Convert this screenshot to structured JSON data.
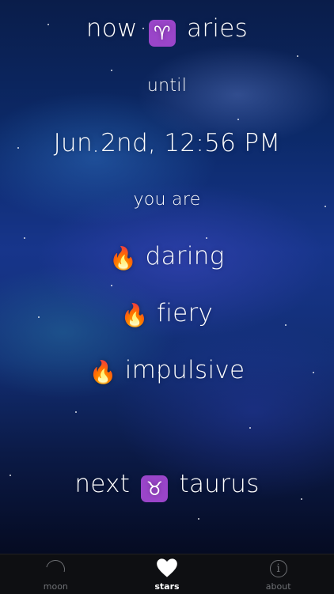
{
  "current": {
    "prefix": "now",
    "sign_glyph": "♈",
    "sign_name": "aries"
  },
  "until_label": "until",
  "until_datetime": "Jun 2nd, 12:56 PM",
  "traits_label": "you are",
  "traits": [
    {
      "emoji": "🔥",
      "text": "daring"
    },
    {
      "emoji": "🔥",
      "text": "fiery"
    },
    {
      "emoji": "🔥",
      "text": "impulsive"
    }
  ],
  "next": {
    "prefix": "next",
    "sign_glyph": "♉",
    "sign_name": "taurus"
  },
  "tabs": [
    {
      "label": "moon",
      "icon": "moon-icon"
    },
    {
      "label": "stars",
      "icon": "heart-icon"
    },
    {
      "label": "about",
      "icon": "info-icon"
    }
  ],
  "colors": {
    "sign_badge": "#9a45c9",
    "tabbar": "#0e0f12",
    "tab_active": "#ffffff",
    "tab_inactive": "#6f7175"
  }
}
